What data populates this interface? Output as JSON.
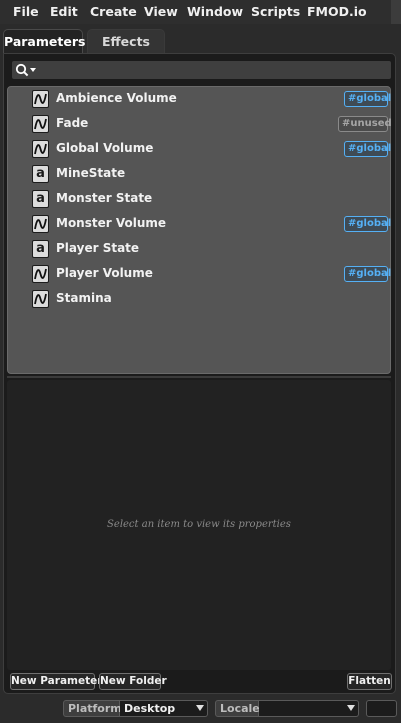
{
  "menu": {
    "items": [
      "File",
      "Edit",
      "Create",
      "View",
      "Window",
      "Scripts",
      "FMOD.io"
    ]
  },
  "tabs": [
    {
      "label": "Parameters",
      "active": true
    },
    {
      "label": "Effects",
      "active": false
    }
  ],
  "search": {
    "value": "",
    "placeholder": ""
  },
  "parameters": [
    {
      "name": "Ambience Volume",
      "icon": "continuous-parameter-icon",
      "badge": "#global"
    },
    {
      "name": "Fade",
      "icon": "continuous-parameter-icon",
      "badge": "#unused"
    },
    {
      "name": "Global Volume",
      "icon": "continuous-parameter-icon",
      "badge": "#global"
    },
    {
      "name": "MineState",
      "icon": "labeled-parameter-icon",
      "icon_letter": "a"
    },
    {
      "name": "Monster State",
      "icon": "labeled-parameter-icon",
      "icon_letter": "a"
    },
    {
      "name": "Monster Volume",
      "icon": "continuous-parameter-icon",
      "badge": "#global"
    },
    {
      "name": "Player State",
      "icon": "labeled-parameter-icon",
      "icon_letter": "a"
    },
    {
      "name": "Player Volume",
      "icon": "continuous-parameter-icon",
      "badge": "#global"
    },
    {
      "name": "Stamina",
      "icon": "continuous-parameter-icon"
    }
  ],
  "properties": {
    "hint": "Select an item to view its properties"
  },
  "buttons": {
    "new_parameter": "New Parameter",
    "new_folder": "New Folder",
    "flatten": "Flatten"
  },
  "status": {
    "platform_label": "Platform",
    "platform_value": "Desktop",
    "locale_label": "Locale",
    "locale_value": ""
  },
  "colors": {
    "global_badge": "#55b0f5",
    "unused_badge": "#a5a5a5",
    "list_background": "#555555"
  }
}
